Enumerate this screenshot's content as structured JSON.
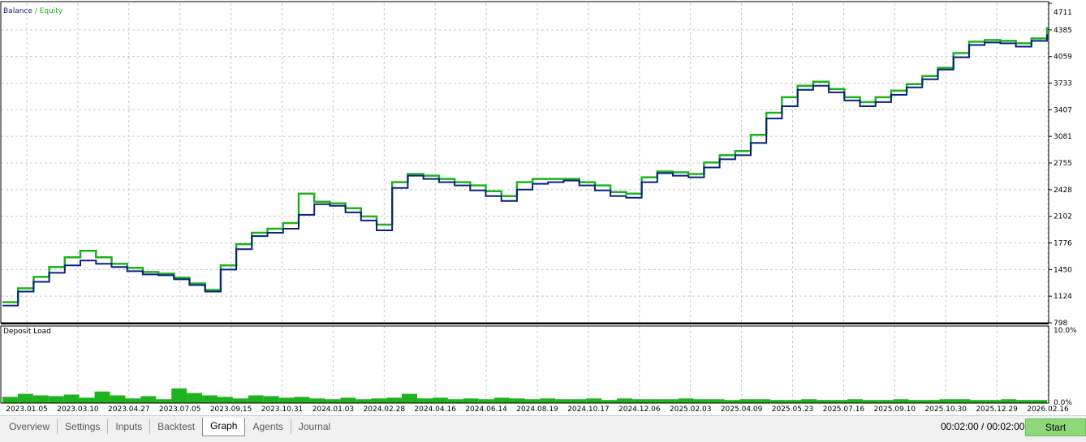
{
  "legend": {
    "balance_label": "Balance",
    "separator": " / ",
    "equity_label": "Equity",
    "balance_color": "#0b2080",
    "equity_color": "#1db31d"
  },
  "deposit_panel": {
    "title": "Deposit Load",
    "bar_color": "#1db31d"
  },
  "chart_data": [
    {
      "type": "line",
      "title": "",
      "series": [
        {
          "name": "Balance",
          "color": "#0b2080",
          "values": [
            1010,
            1180,
            1300,
            1410,
            1500,
            1560,
            1520,
            1480,
            1430,
            1390,
            1380,
            1330,
            1260,
            1180,
            1450,
            1700,
            1860,
            1900,
            1950,
            2120,
            2250,
            2230,
            2150,
            2050,
            1930,
            2450,
            2600,
            2560,
            2520,
            2480,
            2420,
            2350,
            2290,
            2430,
            2500,
            2520,
            2540,
            2480,
            2420,
            2350,
            2330,
            2520,
            2630,
            2600,
            2580,
            2700,
            2800,
            2850,
            3000,
            3300,
            3450,
            3650,
            3700,
            3620,
            3520,
            3450,
            3500,
            3590,
            3680,
            3780,
            3900,
            4050,
            4200,
            4230,
            4220,
            4180,
            4250,
            4330
          ]
        },
        {
          "name": "Equity",
          "color": "#1db31d",
          "values": [
            1050,
            1220,
            1360,
            1480,
            1600,
            1680,
            1600,
            1520,
            1470,
            1420,
            1400,
            1350,
            1280,
            1200,
            1500,
            1760,
            1900,
            1950,
            2020,
            2380,
            2280,
            2260,
            2200,
            2100,
            2000,
            2520,
            2620,
            2600,
            2560,
            2520,
            2480,
            2410,
            2350,
            2520,
            2560,
            2560,
            2560,
            2520,
            2480,
            2400,
            2380,
            2580,
            2650,
            2640,
            2620,
            2760,
            2850,
            2900,
            3100,
            3370,
            3560,
            3700,
            3750,
            3660,
            3560,
            3500,
            3560,
            3640,
            3720,
            3820,
            3920,
            4100,
            4240,
            4260,
            4250,
            4220,
            4280,
            4420
          ]
        }
      ],
      "ylim": [
        798,
        4711
      ],
      "yticks": [
        4711,
        4385,
        4059,
        3733,
        3407,
        3081,
        2755,
        2428,
        2102,
        1776,
        1450,
        1124,
        798
      ],
      "grid": true,
      "legend": "top-left"
    },
    {
      "type": "bar",
      "title": "Deposit Load",
      "ylim": [
        0,
        10
      ],
      "ytick_labels": [
        "10.0%",
        "0.0%"
      ],
      "values": [
        0.8,
        1.2,
        1.0,
        0.9,
        1.1,
        0.7,
        1.5,
        1.0,
        0.6,
        0.9,
        0.5,
        1.9,
        1.3,
        1.0,
        0.8,
        0.6,
        1.0,
        0.9,
        0.7,
        0.8,
        0.6,
        0.5,
        0.7,
        0.5,
        0.6,
        0.7,
        1.2,
        0.6,
        0.7,
        0.5,
        0.6,
        0.5,
        0.7,
        0.6,
        0.5,
        0.6,
        0.5,
        0.5,
        0.6,
        0.4,
        0.6,
        0.5,
        0.5,
        0.5,
        0.6,
        0.5,
        0.5,
        0.4,
        0.5,
        0.5,
        0.4,
        0.4,
        0.5,
        0.4,
        0.4,
        0.5,
        0.4,
        0.4,
        0.5,
        0.4,
        0.4,
        0.5,
        0.5,
        0.4,
        0.4,
        0.5,
        0.4,
        0.4
      ]
    }
  ],
  "x_axis_dates": [
    "2023.01.05",
    "2023.03.10",
    "2023.04.27",
    "2023.07.05",
    "2023.09.15",
    "2023.10.31",
    "2024.01.03",
    "2024.02.28",
    "2024.04.16",
    "2024.06.14",
    "2024.08.19",
    "2024.10.17",
    "2024.12.06",
    "2025.02.03",
    "2025.04.09",
    "2025.05.23",
    "2025.07.16",
    "2025.09.10",
    "2025.10.30",
    "2025.12.29",
    "2026.02.16"
  ],
  "tabs": [
    {
      "label": "Overview",
      "active": false
    },
    {
      "label": "Settings",
      "active": false
    },
    {
      "label": "Inputs",
      "active": false
    },
    {
      "label": "Backtest",
      "active": false
    },
    {
      "label": "Graph",
      "active": true
    },
    {
      "label": "Agents",
      "active": false
    },
    {
      "label": "Journal",
      "active": false
    }
  ],
  "timer": "00:02:00 / 00:02:00",
  "start_button": "Start"
}
